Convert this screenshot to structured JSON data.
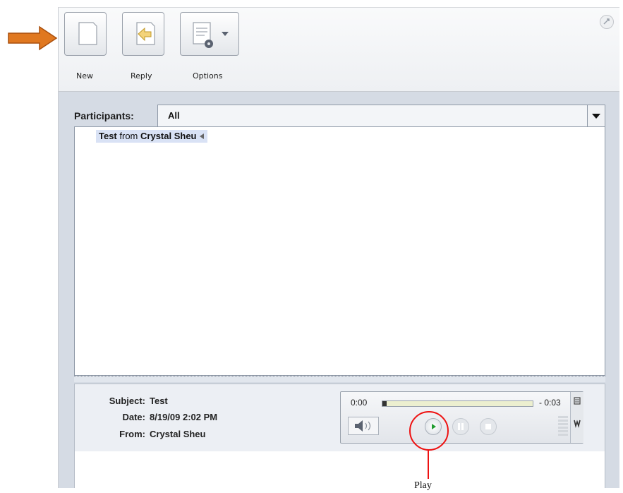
{
  "toolbar": {
    "buttons": [
      {
        "label": "New",
        "icon": "new-document-icon"
      },
      {
        "label": "Reply",
        "icon": "reply-icon"
      },
      {
        "label": "Options",
        "icon": "options-icon"
      }
    ],
    "pin_icon": "pin-icon"
  },
  "participants": {
    "label": "Participants:",
    "selected": "All"
  },
  "messages": [
    {
      "subject": "Test",
      "from_word": "from",
      "sender": "Crystal Sheu",
      "icon": "audio-indicator-icon"
    }
  ],
  "details": {
    "subject_label": "Subject:",
    "subject": "Test",
    "date_label": "Date:",
    "date": "8/19/09 2:02 PM",
    "from_label": "From:",
    "from": "Crystal Sheu"
  },
  "player": {
    "current_time": "0:00",
    "remaining_time": "- 0:03",
    "progress": 0.02
  },
  "annotation": {
    "label": "Play",
    "colors": {
      "arrow": "#e07820",
      "ring": "#e01010"
    }
  }
}
